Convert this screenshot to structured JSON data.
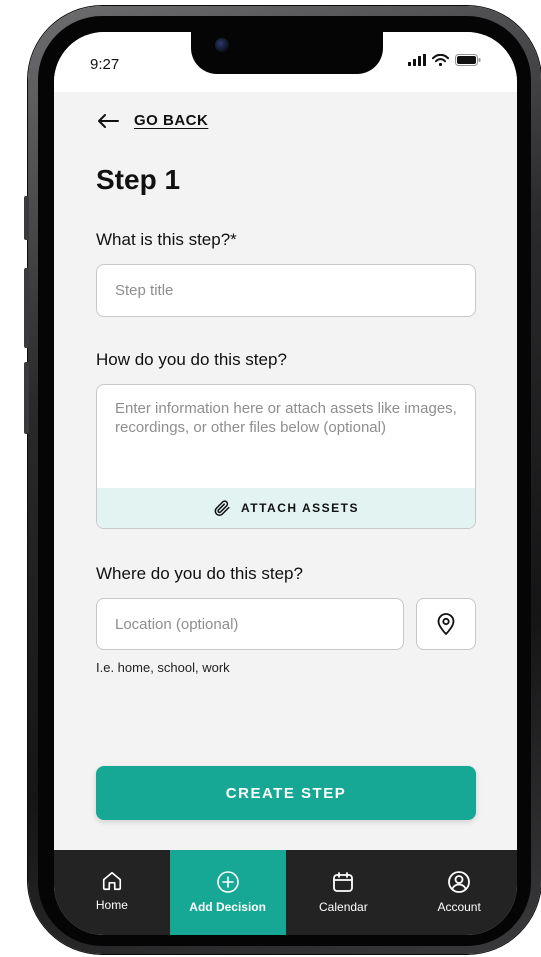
{
  "status_bar": {
    "time": "9:27",
    "icons": [
      "signal-icon",
      "wifi-icon",
      "battery-icon"
    ]
  },
  "header": {
    "back_label": "GO BACK",
    "title": "Step 1"
  },
  "form": {
    "step_title": {
      "label": "What is this step?*",
      "placeholder": "Step title",
      "value": ""
    },
    "step_description": {
      "label": "How do you do this step?",
      "placeholder": "Enter information here or attach assets like images, recordings, or other files below (optional)",
      "value": "",
      "attach_label": "ATTACH ASSETS"
    },
    "step_location": {
      "label": "Where do you do this step?",
      "placeholder": "Location (optional)",
      "value": "",
      "helper": "I.e. home, school, work"
    },
    "submit_label": "CREATE STEP"
  },
  "bottom_nav": {
    "items": [
      {
        "label": "Home",
        "icon": "home-icon",
        "active": false
      },
      {
        "label": "Add Decision",
        "icon": "plus-circle-icon",
        "active": true
      },
      {
        "label": "Calendar",
        "icon": "calendar-icon",
        "active": false
      },
      {
        "label": "Account",
        "icon": "account-icon",
        "active": false
      }
    ]
  },
  "colors": {
    "accent": "#16a894",
    "attach_bar": "#e2f3f2",
    "screen_bg": "#f3f3f3",
    "nav_bg": "#232323"
  }
}
